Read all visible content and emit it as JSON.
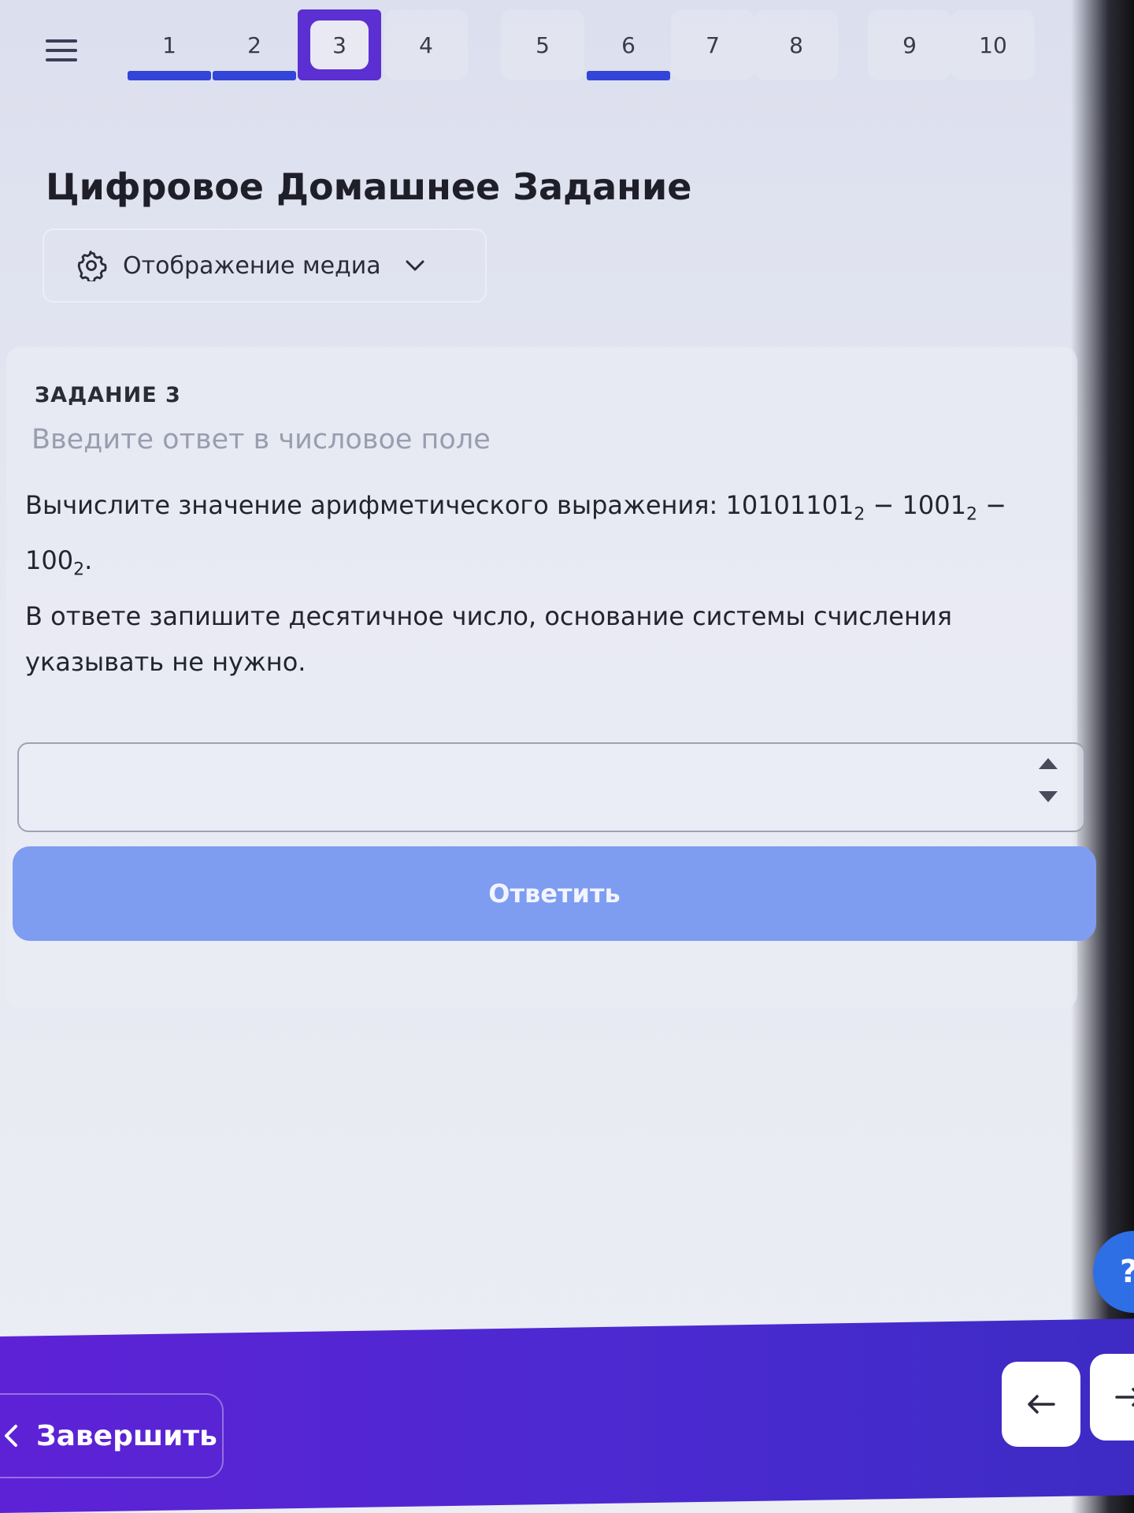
{
  "nav": {
    "tabs": [
      {
        "label": "1",
        "state": "done"
      },
      {
        "label": "2",
        "state": "done"
      },
      {
        "label": "3",
        "state": "active"
      },
      {
        "label": "4",
        "state": "plain"
      },
      {
        "label": "5",
        "state": "plain"
      },
      {
        "label": "6",
        "state": "done"
      },
      {
        "label": "7",
        "state": "plain"
      },
      {
        "label": "8",
        "state": "plain"
      },
      {
        "label": "9",
        "state": "plain"
      },
      {
        "label": "10",
        "state": "plain"
      }
    ]
  },
  "header": {
    "title": "Цифровое Домашнее Задание",
    "media_label": "Отображение медиа"
  },
  "task": {
    "number_label": "ЗАДАНИЕ 3",
    "hint": "Введите ответ в числовое поле",
    "question_prefix": "Вычислите значение арифметического выражения: ",
    "n1": "10101101",
    "n2": "1001",
    "n3": "100",
    "base": "2",
    "minus": " − ",
    "dot": ".",
    "question_rest": "В ответе запишите десятичное число, основание системы счисления указывать не нужно.",
    "answer_value": ""
  },
  "actions": {
    "submit_label": "Ответить",
    "help_label": "?",
    "finish_label": "Завершить"
  },
  "colors": {
    "accent": "#5b2fd1",
    "progress": "#3344d8",
    "submit": "#7e9cf0",
    "bottom_bar": "#4a2ad0",
    "help": "#2f6fe6"
  }
}
